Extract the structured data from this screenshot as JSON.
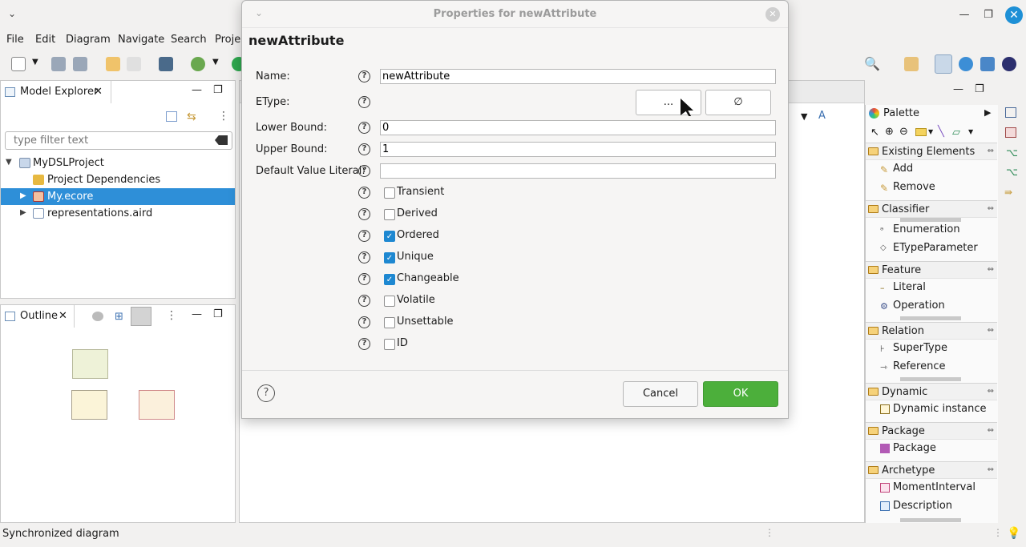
{
  "window": {
    "close_symbol": "✕",
    "minimize_symbol": "—",
    "restore_symbol": "❐"
  },
  "menu": [
    "File",
    "Edit",
    "Diagram",
    "Navigate",
    "Search",
    "Projec"
  ],
  "model_explorer": {
    "tab_label": "Model Explorer",
    "filter_placeholder": "type filter text",
    "tree": [
      {
        "label": "MyDSLProject",
        "icon": "project-icon"
      },
      {
        "label": "Project Dependencies",
        "icon": "dependencies-icon"
      },
      {
        "label": "My.ecore",
        "icon": "ecore-icon",
        "selected": true
      },
      {
        "label": "representations.aird",
        "icon": "aird-icon"
      }
    ]
  },
  "outline": {
    "tab_label": "Outline"
  },
  "palette": {
    "title": "Palette",
    "sections": [
      {
        "label": "Existing Elements",
        "items": [
          "Add",
          "Remove"
        ]
      },
      {
        "label": "Classifier",
        "items": [
          "Enumeration",
          "ETypeParameter"
        ]
      },
      {
        "label": "Feature",
        "items": [
          "Literal",
          "Operation"
        ]
      },
      {
        "label": "Relation",
        "items": [
          "SuperType",
          "Reference"
        ]
      },
      {
        "label": "Dynamic",
        "items": [
          "Dynamic instance"
        ]
      },
      {
        "label": "Package",
        "items": [
          "Package"
        ]
      },
      {
        "label": "Archetype",
        "items": [
          "MomentInterval",
          "Description"
        ]
      }
    ]
  },
  "dialog": {
    "title": "Properties for newAttribute",
    "heading": "newAttribute",
    "fields": {
      "name_label": "Name:",
      "name_value": "newAttribute",
      "etype_label": "EType:",
      "etype_browse": "...",
      "etype_clear": "∅",
      "lower_label": "Lower Bound:",
      "lower_value": "0",
      "upper_label": "Upper Bound:",
      "upper_value": "1",
      "default_label": "Default Value Literal:",
      "default_value": ""
    },
    "checkboxes": [
      {
        "label": "Transient",
        "checked": false
      },
      {
        "label": "Derived",
        "checked": false
      },
      {
        "label": "Ordered",
        "checked": true
      },
      {
        "label": "Unique",
        "checked": true
      },
      {
        "label": "Changeable",
        "checked": true
      },
      {
        "label": "Volatile",
        "checked": false
      },
      {
        "label": "Unsettable",
        "checked": false
      },
      {
        "label": "ID",
        "checked": false
      }
    ],
    "cancel_label": "Cancel",
    "ok_label": "OK",
    "accent": "#4caf3b"
  },
  "status": {
    "text": "Synchronized diagram"
  }
}
